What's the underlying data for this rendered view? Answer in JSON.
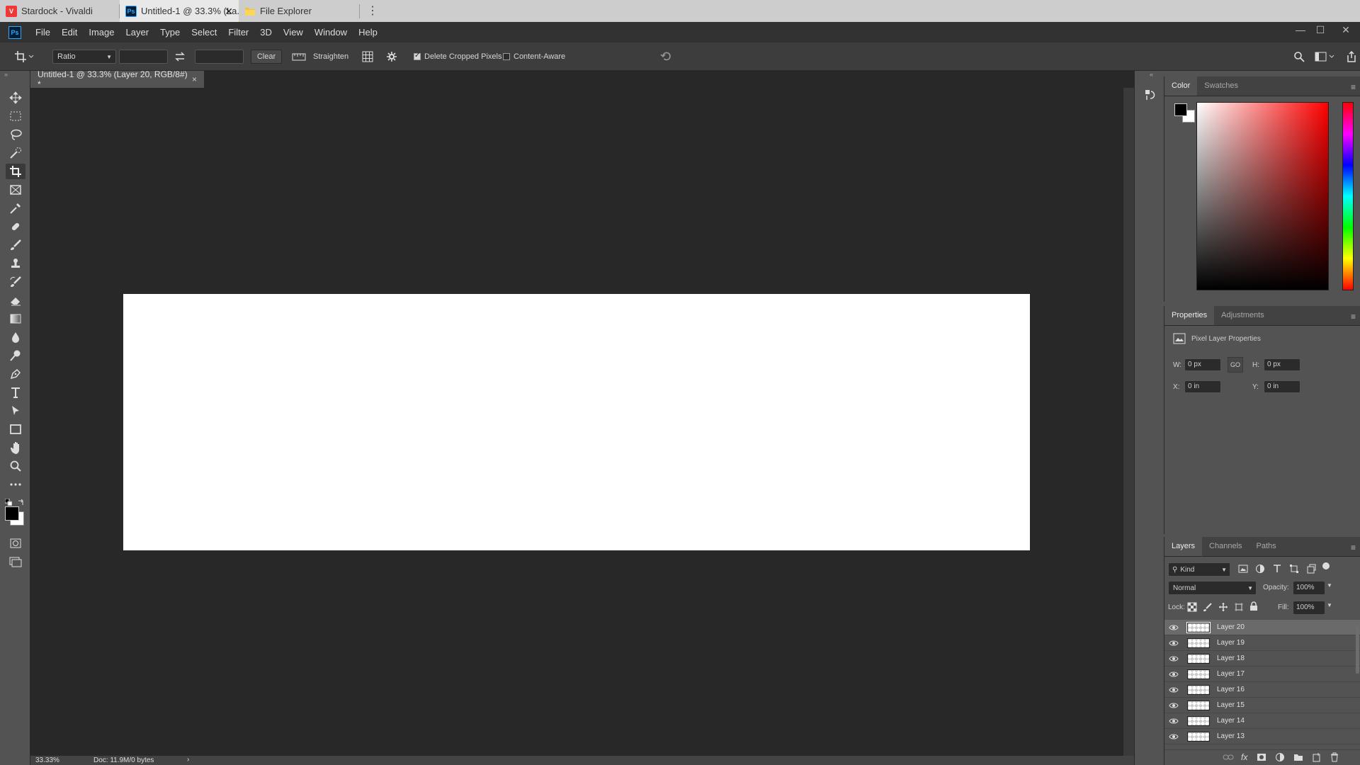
{
  "browser": {
    "tabs": [
      {
        "title": "Stardock - Vivaldi",
        "icon": "vivaldi-icon"
      },
      {
        "title": "Untitled-1 @ 33.3% (La...",
        "icon": "photoshop-icon"
      },
      {
        "title": "File Explorer",
        "icon": "folder-icon"
      }
    ],
    "close_glyph": "✕",
    "more_glyph": "⋮"
  },
  "app": {
    "logo": "Ps",
    "menu": [
      "File",
      "Edit",
      "Image",
      "Layer",
      "Type",
      "Select",
      "Filter",
      "3D",
      "View",
      "Window",
      "Help"
    ],
    "window_controls": {
      "minimize": "—",
      "maximize": "☐",
      "close": "✕"
    }
  },
  "options": {
    "preset_select": "Ratio",
    "width_value": "",
    "height_value": "",
    "clear_label": "Clear",
    "straighten_label": "Straighten",
    "delete_cropped_label": "Delete Cropped Pixels",
    "delete_cropped_checked": true,
    "content_aware_label": "Content-Aware",
    "content_aware_checked": false
  },
  "document": {
    "tab_title": "Untitled-1 @ 33.3% (Layer 20, RGB/8#) *",
    "close_glyph": "×",
    "zoom": "33.33%",
    "doc_info": "Doc: 11.9M/0 bytes",
    "status_arrow": "›"
  },
  "color_panel": {
    "tabs": [
      "Color",
      "Swatches"
    ],
    "foreground": "#000000",
    "background": "#ffffff",
    "hue_color": "#ff0000"
  },
  "properties_panel": {
    "tabs": [
      "Properties",
      "Adjustments"
    ],
    "title": "Pixel Layer Properties",
    "w_label": "W:",
    "w_value": "0 px",
    "link_label": "GO",
    "h_label": "H:",
    "h_value": "0 px",
    "x_label": "X:",
    "x_value": "0 in",
    "y_label": "Y:",
    "y_value": "0 in"
  },
  "layers_panel": {
    "tabs": [
      "Layers",
      "Channels",
      "Paths"
    ],
    "filter_kind": "Kind",
    "blend_mode": "Normal",
    "opacity_label": "Opacity:",
    "opacity_value": "100%",
    "lock_label": "Lock:",
    "fill_label": "Fill:",
    "fill_value": "100%",
    "layers": [
      {
        "name": "Layer 20",
        "selected": true
      },
      {
        "name": "Layer 19",
        "selected": false
      },
      {
        "name": "Layer 18",
        "selected": false
      },
      {
        "name": "Layer 17",
        "selected": false
      },
      {
        "name": "Layer 16",
        "selected": false
      },
      {
        "name": "Layer 15",
        "selected": false
      },
      {
        "name": "Layer 14",
        "selected": false
      },
      {
        "name": "Layer 13",
        "selected": false
      }
    ]
  },
  "colors": {
    "app_dark": "#282828",
    "panel": "#535353",
    "accent_ps": "#31a8ff"
  }
}
